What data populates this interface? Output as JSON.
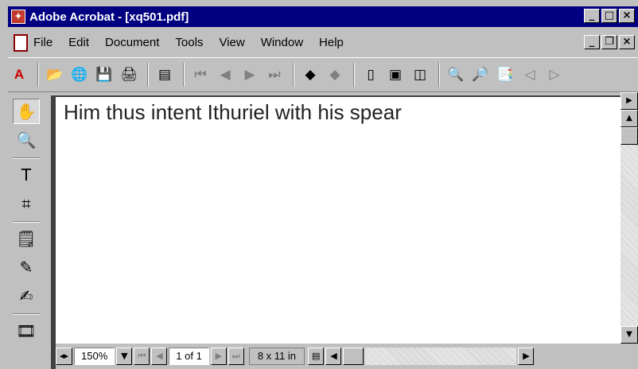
{
  "window": {
    "title": "Adobe Acrobat - [xq501.pdf]",
    "controls": {
      "minimize": "_",
      "maximize": "□",
      "close": "×"
    }
  },
  "menubar": {
    "items": [
      "File",
      "Edit",
      "Document",
      "Tools",
      "View",
      "Window",
      "Help"
    ],
    "doc_controls": {
      "minimize": "_",
      "restore": "❐",
      "close": "×"
    }
  },
  "toolbar": {
    "icons": [
      {
        "name": "acrobat-logo-icon",
        "glyph": "A"
      },
      {
        "name": "open-folder-icon",
        "glyph": "📂"
      },
      {
        "name": "open-web-icon",
        "glyph": "🌐"
      },
      {
        "name": "save-icon",
        "glyph": "💾"
      },
      {
        "name": "print-icon",
        "glyph": "🖨"
      },
      {
        "name": "show-navigation-pane-icon",
        "glyph": "▤"
      },
      {
        "name": "first-page-icon",
        "glyph": "⏮"
      },
      {
        "name": "previous-page-icon",
        "glyph": "◀"
      },
      {
        "name": "next-page-icon",
        "glyph": "▶"
      },
      {
        "name": "last-page-icon",
        "glyph": "⏭"
      },
      {
        "name": "go-back-icon",
        "glyph": "◆"
      },
      {
        "name": "go-forward-icon",
        "glyph": "◆"
      },
      {
        "name": "actual-size-icon",
        "glyph": "▯"
      },
      {
        "name": "fit-page-icon",
        "glyph": "▣"
      },
      {
        "name": "fit-width-icon",
        "glyph": "◫"
      },
      {
        "name": "find-icon",
        "glyph": "🔍"
      },
      {
        "name": "search-icon",
        "glyph": "🔎"
      },
      {
        "name": "search-results-icon",
        "glyph": "📑"
      },
      {
        "name": "previous-highlight-icon",
        "glyph": "◁"
      },
      {
        "name": "next-highlight-icon",
        "glyph": "▷"
      }
    ]
  },
  "left_tools": [
    {
      "name": "hand-tool-icon",
      "glyph": "✋"
    },
    {
      "name": "zoom-tool-icon",
      "glyph": "🔍"
    },
    {
      "name": "text-select-tool-icon",
      "glyph": "T"
    },
    {
      "name": "crop-tool-icon",
      "glyph": "⌗"
    },
    {
      "name": "note-tool-icon",
      "glyph": "🗒"
    },
    {
      "name": "pencil-tool-icon",
      "glyph": "✎"
    },
    {
      "name": "highlight-tool-icon",
      "glyph": "✍"
    },
    {
      "name": "movie-tool-icon",
      "glyph": "🎞"
    }
  ],
  "document": {
    "text": "Him thus intent Ithuriel with his spear"
  },
  "statusbar": {
    "zoom": "150%",
    "page": "1 of 1",
    "page_size": "8 x 11 in"
  }
}
